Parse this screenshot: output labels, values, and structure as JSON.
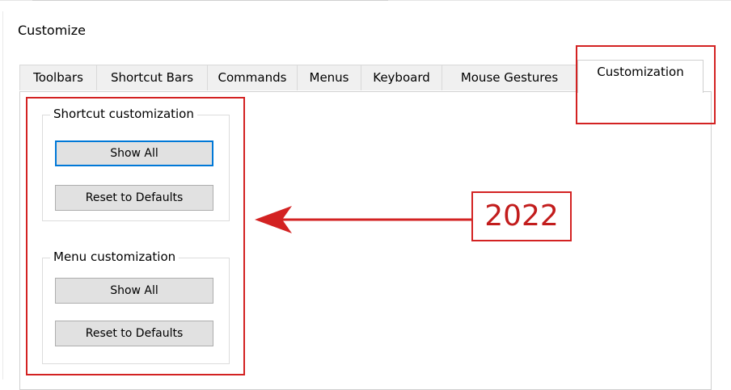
{
  "window": {
    "title": "Customize"
  },
  "tabs": [
    {
      "label": "Toolbars"
    },
    {
      "label": "Shortcut Bars"
    },
    {
      "label": "Commands"
    },
    {
      "label": "Menus"
    },
    {
      "label": "Keyboard"
    },
    {
      "label": "Mouse Gestures"
    },
    {
      "label": "Customization",
      "active": true
    }
  ],
  "shortcut_group": {
    "title": "Shortcut customization",
    "show_all_label": "Show All",
    "reset_label": "Reset to Defaults"
  },
  "menu_group": {
    "title": "Menu customization",
    "show_all_label": "Show All",
    "reset_label": "Reset to Defaults"
  },
  "annotation": {
    "label": "2022",
    "color": "#d32222",
    "arrow_icon": "arrow-left-icon"
  }
}
